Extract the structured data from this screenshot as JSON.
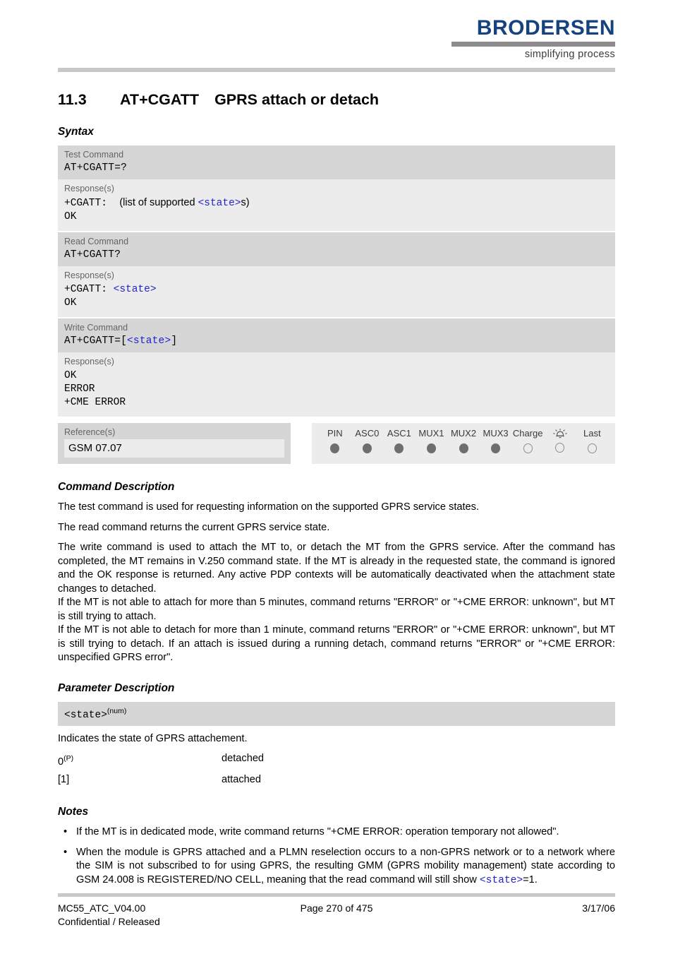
{
  "header": {
    "logo_word": "BRODERSEN",
    "logo_tagline": "simplifying process",
    "brand_color": "#16437e"
  },
  "title": {
    "number": "11.3",
    "command": "AT+CGATT",
    "description": "GPRS attach or detach"
  },
  "sections": {
    "syntax": "Syntax",
    "command_description": "Command Description",
    "parameter_description": "Parameter Description",
    "notes": "Notes"
  },
  "syntax": {
    "blocks": [
      {
        "head_label": "Test Command",
        "command_prefix": "AT+CGATT=?",
        "response_label": "Response(s)",
        "response_prefix": "+CGATT:",
        "response_middle": "(list of supported ",
        "response_param": "<state>",
        "response_suffix": "s)",
        "response_ok": "OK"
      },
      {
        "head_label": "Read Command",
        "command_prefix": "AT+CGATT?",
        "response_label": "Response(s)",
        "response_prefix": "+CGATT:",
        "response_param": "<state>",
        "response_ok": "OK"
      },
      {
        "head_label": "Write Command",
        "command_prefix": "AT+CGATT=[",
        "command_param": "<state>",
        "command_suffix": "]",
        "response_label": "Response(s)",
        "response_lines": "OK\nERROR\n+CME ERROR"
      }
    ]
  },
  "reference": {
    "label": "Reference(s)",
    "value": "GSM 07.07"
  },
  "capabilities": {
    "columns": [
      {
        "label": "PIN",
        "state": "filled"
      },
      {
        "label": "ASC0",
        "state": "filled"
      },
      {
        "label": "ASC1",
        "state": "filled"
      },
      {
        "label": "MUX1",
        "state": "filled"
      },
      {
        "label": "MUX2",
        "state": "filled"
      },
      {
        "label": "MUX3",
        "state": "filled"
      },
      {
        "label": "Charge",
        "state": "hollow"
      },
      {
        "label": "alarm-icon",
        "state": "hollow"
      },
      {
        "label": "Last",
        "state": "hollow"
      }
    ]
  },
  "command_description": {
    "paragraphs": [
      "The test command is used for requesting information on the supported GPRS service states.",
      "The read command returns the current GPRS service state.",
      "The write command is used to attach the MT to, or detach the MT from the GPRS service. After the command has completed, the MT remains in V.250 command state. If the MT is already in the requested state, the command is ignored and the OK response is returned. Any active PDP contexts will be automatically deactivated when the attachment state changes to detached.",
      "If the MT is not able to attach for more than 5 minutes, command returns \"ERROR\" or \"+CME ERROR: unknown\", but MT is still trying to attach.",
      "If the MT is not able to detach for more than 1 minute, command returns \"ERROR\" or \"+CME ERROR: unknown\", but MT is still trying to detach. If an attach is issued during a running detach, command returns \"ERROR\" or \"+CME ERROR: unspecified GPRS error\"."
    ]
  },
  "parameter": {
    "name": "<state>",
    "type_superscript": "(num)",
    "intro": "Indicates the state of GPRS attachement.",
    "values": [
      {
        "value": "0",
        "superscript": "(P)",
        "meaning": "detached"
      },
      {
        "value": "[1]",
        "superscript": "",
        "meaning": "attached"
      }
    ]
  },
  "notes": {
    "bullet": "•",
    "items": [
      {
        "text": "If the MT is in dedicated mode, write command returns \"+CME ERROR: operation temporary not allowed\".",
        "trailing_param": "",
        "trailing_text": ""
      },
      {
        "text": "When the module is GPRS attached and a PLMN reselection occurs to a non-GPRS network or to a network where the SIM is not subscribed to for using GPRS, the resulting GMM (GPRS mobility management) state according to GSM 24.008 is REGISTERED/NO CELL, meaning that the read command will still show ",
        "trailing_param": "<state>",
        "trailing_text": "=1."
      }
    ]
  },
  "footer": {
    "document_id": "MC55_ATC_V04.00",
    "classification": "Confidential / Released",
    "page": "Page 270 of 475",
    "date": "3/17/06"
  }
}
